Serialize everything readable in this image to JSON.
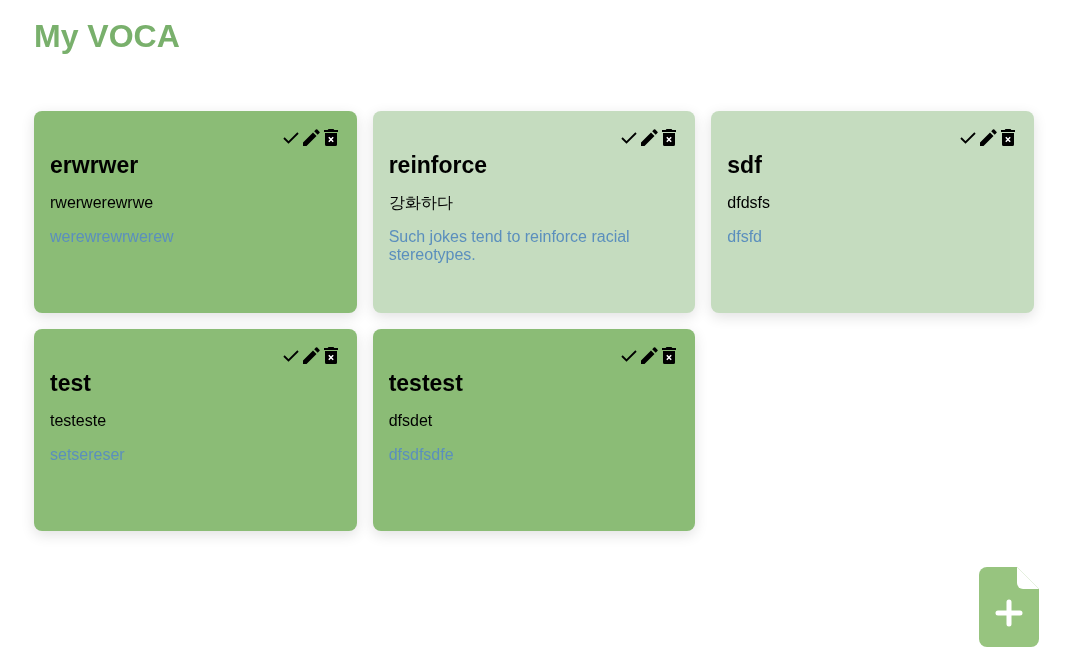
{
  "title": "My VOCA",
  "cards": [
    {
      "word": "erwrwer",
      "meaning": "rwerwerewrwe",
      "example": "werewrewrwerew",
      "done": false
    },
    {
      "word": "reinforce",
      "meaning": "강화하다",
      "example": "Such jokes tend to reinforce racial stereotypes.",
      "done": true
    },
    {
      "word": "sdf",
      "meaning": "dfdsfs",
      "example": "dfsfd",
      "done": true
    },
    {
      "word": "test",
      "meaning": "testeste",
      "example": "setsereser",
      "done": false
    },
    {
      "word": "testest",
      "meaning": "dfsdet",
      "example": "dfsdfsdfe",
      "done": false
    }
  ]
}
